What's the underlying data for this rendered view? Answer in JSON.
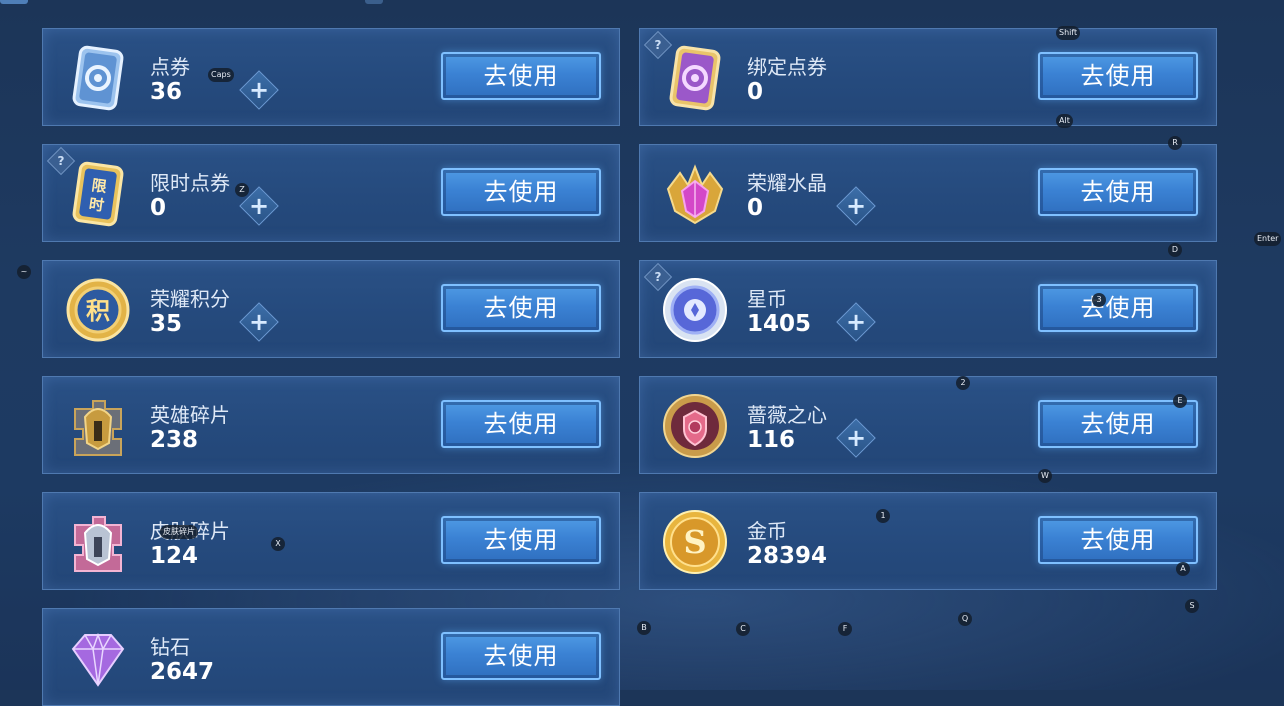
{
  "button_label": "去使用",
  "plus_symbol": "+",
  "help_symbol": "?",
  "currencies": [
    {
      "name": "点券",
      "value": "36",
      "icon": "coupon-card-icon"
    },
    {
      "name": "绑定点券",
      "value": "0",
      "icon": "bound-coupon-card-icon"
    },
    {
      "name": "限时点券",
      "value": "0",
      "icon": "limited-coupon-card-icon",
      "icon_text": "限时"
    },
    {
      "name": "荣耀水晶",
      "value": "0",
      "icon": "honor-crystal-icon"
    },
    {
      "name": "荣耀积分",
      "value": "35",
      "icon": "honor-points-icon",
      "icon_text": "积"
    },
    {
      "name": "星币",
      "value": "1405",
      "icon": "star-coin-icon"
    },
    {
      "name": "英雄碎片",
      "value": "238",
      "icon": "hero-fragment-icon"
    },
    {
      "name": "蔷薇之心",
      "value": "116",
      "icon": "rose-heart-icon"
    },
    {
      "name": "皮肤碎片",
      "value": "124",
      "icon": "skin-fragment-icon"
    },
    {
      "name": "金币",
      "value": "28394",
      "icon": "gold-coin-icon",
      "icon_text": "S"
    },
    {
      "name": "钻石",
      "value": "2647",
      "icon": "diamond-icon"
    }
  ],
  "key_hints": [
    "Caps",
    "Shift",
    "Alt",
    "Z",
    "R",
    "Enter",
    "D",
    "~",
    "3",
    "2",
    "E",
    "W",
    "1",
    "X",
    "A",
    "S",
    "Q",
    "B",
    "C",
    "F",
    "皮肤碎片"
  ],
  "colors": {
    "button": "#3b82d4",
    "card": "#254a7d",
    "border": "#4f79b0",
    "background": "#1d3a62"
  }
}
